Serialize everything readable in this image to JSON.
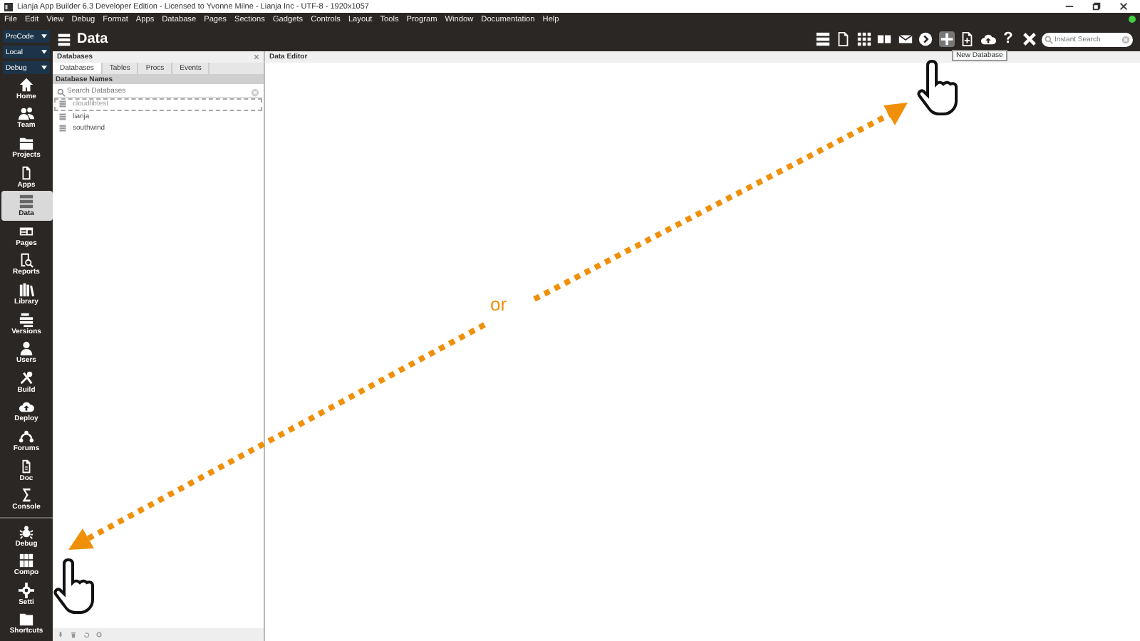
{
  "window": {
    "title": "Lianja App Builder 6.3 Developer Edition - Licensed to Yvonne Milne - Lianja Inc - UTF-8 - 1920x1057"
  },
  "menu": [
    "File",
    "Edit",
    "View",
    "Debug",
    "Format",
    "Apps",
    "Database",
    "Pages",
    "Sections",
    "Gadgets",
    "Controls",
    "Layout",
    "Tools",
    "Program",
    "Window",
    "Documentation",
    "Help"
  ],
  "selectors": [
    {
      "label": "ProCode"
    },
    {
      "label": "Local"
    },
    {
      "label": "Debug"
    }
  ],
  "nav": [
    {
      "label": "Home",
      "selected": false
    },
    {
      "label": "Team",
      "selected": false
    },
    {
      "label": "Projects",
      "selected": false
    },
    {
      "label": "Apps",
      "selected": false
    },
    {
      "label": "Data",
      "selected": true
    },
    {
      "label": "Pages",
      "selected": false
    },
    {
      "label": "Reports",
      "selected": false
    },
    {
      "label": "Library",
      "selected": false
    },
    {
      "label": "Versions",
      "selected": false
    },
    {
      "label": "Users",
      "selected": false
    },
    {
      "label": "Build",
      "selected": false
    },
    {
      "label": "Deploy",
      "selected": false
    },
    {
      "label": "Forums",
      "selected": false
    },
    {
      "label": "Doc",
      "selected": false
    },
    {
      "label": "Console",
      "selected": false
    }
  ],
  "nav_bottom": [
    {
      "label": "Debug",
      "selected": false
    },
    {
      "label": "Compo",
      "selected": false
    },
    {
      "label": "Setti",
      "selected": false
    },
    {
      "label": "Shortcuts",
      "selected": false
    }
  ],
  "page_title": "Data",
  "toolbar": [
    {
      "selected": false
    },
    {
      "selected": false
    },
    {
      "selected": false
    },
    {
      "selected": false
    },
    {
      "selected": false
    },
    {
      "selected": false
    },
    {
      "selected": true
    },
    {
      "selected": false
    },
    {
      "selected": false
    },
    {
      "glyph": "?",
      "selected": false
    },
    {
      "selected": false
    }
  ],
  "search": {
    "placeholder": "Instant Search"
  },
  "tooltip": "New Database",
  "databases_panel": {
    "title": "Databases",
    "tabs": [
      {
        "label": "Databases",
        "selected": true
      },
      {
        "label": "Tables",
        "selected": false
      },
      {
        "label": "Procs",
        "selected": false
      },
      {
        "label": "Events",
        "selected": false
      }
    ],
    "list_header": "Database Names",
    "search": {
      "placeholder": "Search Databases"
    },
    "items": [
      {
        "name": "cloudlibtest",
        "selected": true
      },
      {
        "name": "lianja",
        "selected": false
      },
      {
        "name": "southwind",
        "selected": false
      }
    ]
  },
  "editor": {
    "title": "Data Editor"
  },
  "annotation": {
    "text": "or"
  }
}
